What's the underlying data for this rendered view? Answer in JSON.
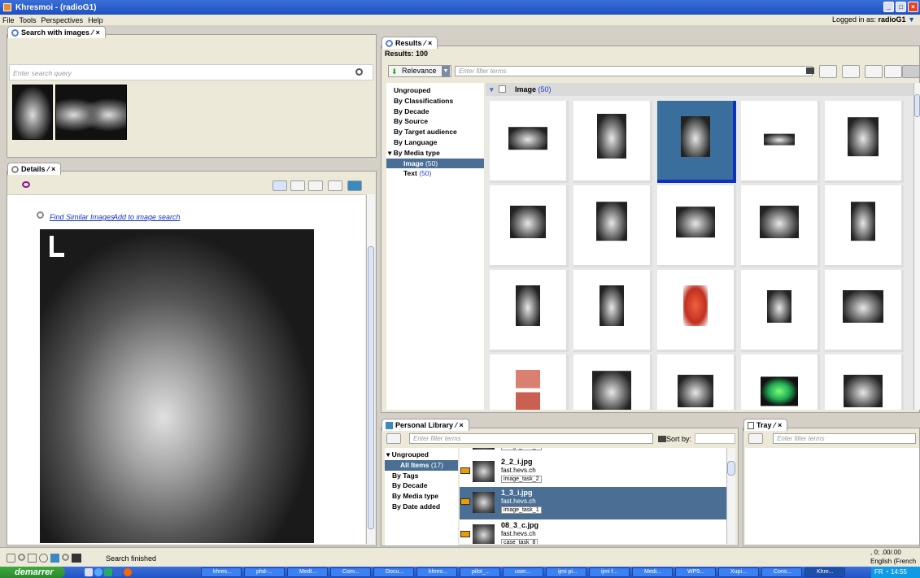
{
  "window": {
    "title": "Khresmoi - (radioG1)"
  },
  "menu": {
    "items": [
      "File",
      "Tools",
      "Perspectives",
      "Help"
    ],
    "logged_in_label": "Logged in as:",
    "user": "radioG1"
  },
  "search_panel": {
    "tab_label": "Search with images",
    "placeholder": "Enter search query"
  },
  "details_panel": {
    "tab_label": "Details",
    "find_similar": "Find Similar Images",
    "add_to_search": "Add to image search"
  },
  "results_panel": {
    "tab_label": "Results",
    "results_count": "Results: 100",
    "sort_label": "Relevance",
    "filter_placeholder": "Enter filter terms",
    "groups": [
      "Ungrouped",
      "By Classifications",
      "By Decade",
      "By Source",
      "By Target audience",
      "By Language",
      "By Media type"
    ],
    "media_children": [
      {
        "label": "Image",
        "count": "(50)"
      },
      {
        "label": "Text",
        "count": "(50)"
      }
    ],
    "group_header": "Image",
    "group_count": "(50)"
  },
  "library_panel": {
    "tab_label": "Personal Library",
    "filter_placeholder": "Enter filter terms",
    "sort_label": "Sort by:",
    "groups": [
      "By Tags",
      "By Decade",
      "By Media type",
      "By Date added"
    ],
    "ungrouped": "Ungrouped",
    "all_items": "All Items",
    "all_items_count": "(17)",
    "items": [
      {
        "name": "",
        "source": "",
        "task": "image_task_2"
      },
      {
        "name": "2_2_i.jpg",
        "source": "fast.hevs.ch",
        "task": "image_task_2"
      },
      {
        "name": "1_3_i.jpg",
        "source": "fast.hevs.ch",
        "task": "image_task_1"
      },
      {
        "name": "08_3_c.jpg",
        "source": "fast.hevs.ch",
        "task": "case_task_8"
      }
    ]
  },
  "tray_panel": {
    "tab_label": "Tray",
    "filter_placeholder": "Enter filter terms"
  },
  "status": {
    "text": "Search finished",
    "coords": ", 0; .00/.00",
    "lang": "English (French"
  },
  "taskbar": {
    "start": "demarrer",
    "tasks": [
      "khres...",
      "phd-...",
      "MedI...",
      "Com...",
      "Docu...",
      "khres...",
      "pilot_...",
      "user...",
      "ijmi pi...",
      "ijmi f...",
      "Medi...",
      "WP9...",
      "Xupi...",
      "Cons...",
      "Khre..."
    ],
    "tray_lang": "FR",
    "clock": "14:55"
  },
  "colors": {
    "selection": "#4b6f94",
    "link": "#1530c8",
    "title_bar": "#2a5fd2"
  }
}
